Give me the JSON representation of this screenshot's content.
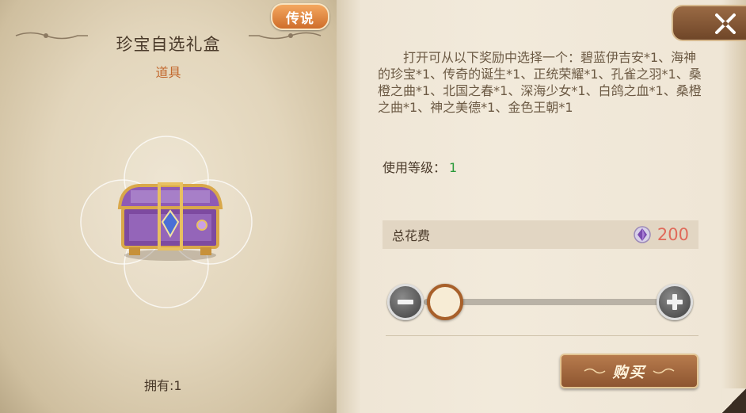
{
  "item": {
    "name": "珍宝自选礼盒",
    "type": "道具",
    "rarity": "传说",
    "owned_label": "拥有:1"
  },
  "details": {
    "description": "打开可从以下奖励中选择一个：碧蓝伊吉安*1、海神的珍宝*1、传奇的诞生*1、正统荣耀*1、孔雀之羽*1、桑橙之曲*1、北国之春*1、深海少女*1、白鸽之血*1、桑橙之曲*1、神之美德*1、金色王朝*1",
    "level_label": "使用等级：",
    "level_value": "1"
  },
  "purchase": {
    "total_label": "总花费",
    "total_value": "200",
    "currency_icon": "purple-gem-icon",
    "quantity_fraction": 0.0,
    "buy_label": "购买"
  },
  "colors": {
    "rarity": "#e08840",
    "item_type": "#c2682e",
    "level_value": "#2a9a3a",
    "cost": "#e06a5a",
    "button": "#9a643c"
  }
}
